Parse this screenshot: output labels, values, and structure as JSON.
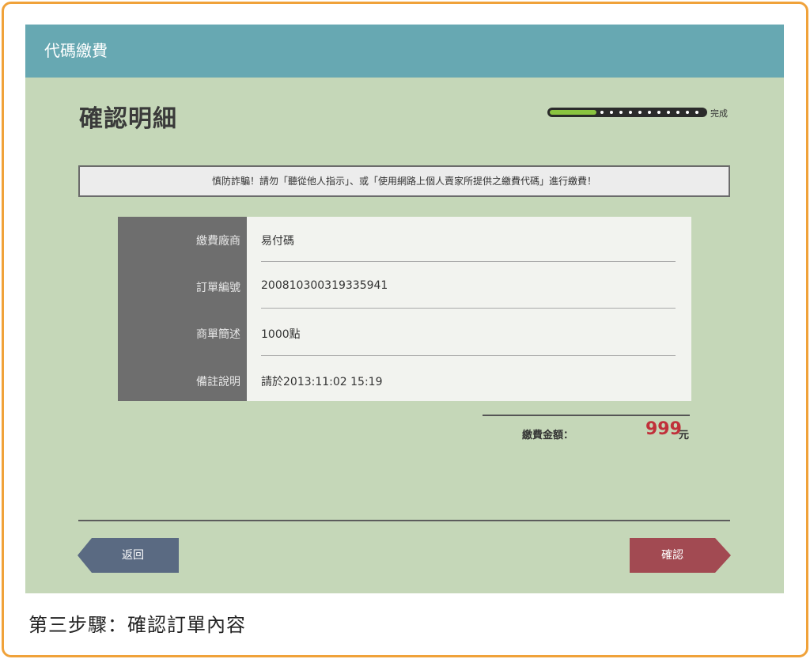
{
  "header": {
    "title": "代碼繳費"
  },
  "page": {
    "title": "確認明細"
  },
  "progress": {
    "label": "完成",
    "fraction": 0.3
  },
  "warning": {
    "text": "慎防詐騙！請勿「聽從他人指示」、或「使用網路上個人賣家所提供之繳費代碼」進行繳費！"
  },
  "details": [
    {
      "label": "繳費廠商",
      "value": "易付碼"
    },
    {
      "label": "訂單編號",
      "value": "200810300319335941"
    },
    {
      "label": "商單簡述",
      "value": "1000點"
    },
    {
      "label": "備註說明",
      "value": "請於2013:11:02 15:19"
    }
  ],
  "total": {
    "label": "繳費金額：",
    "amount": "999",
    "unit": "元"
  },
  "buttons": {
    "back": "返回",
    "confirm": "確認"
  },
  "caption": "第三步驟：確認訂單內容",
  "colors": {
    "header": "#67a8b2",
    "background": "#c5d7b8",
    "amount": "#c0303a",
    "back_button": "#5a6a82",
    "confirm_button": "#a24a52",
    "frame": "#f0a23a"
  }
}
